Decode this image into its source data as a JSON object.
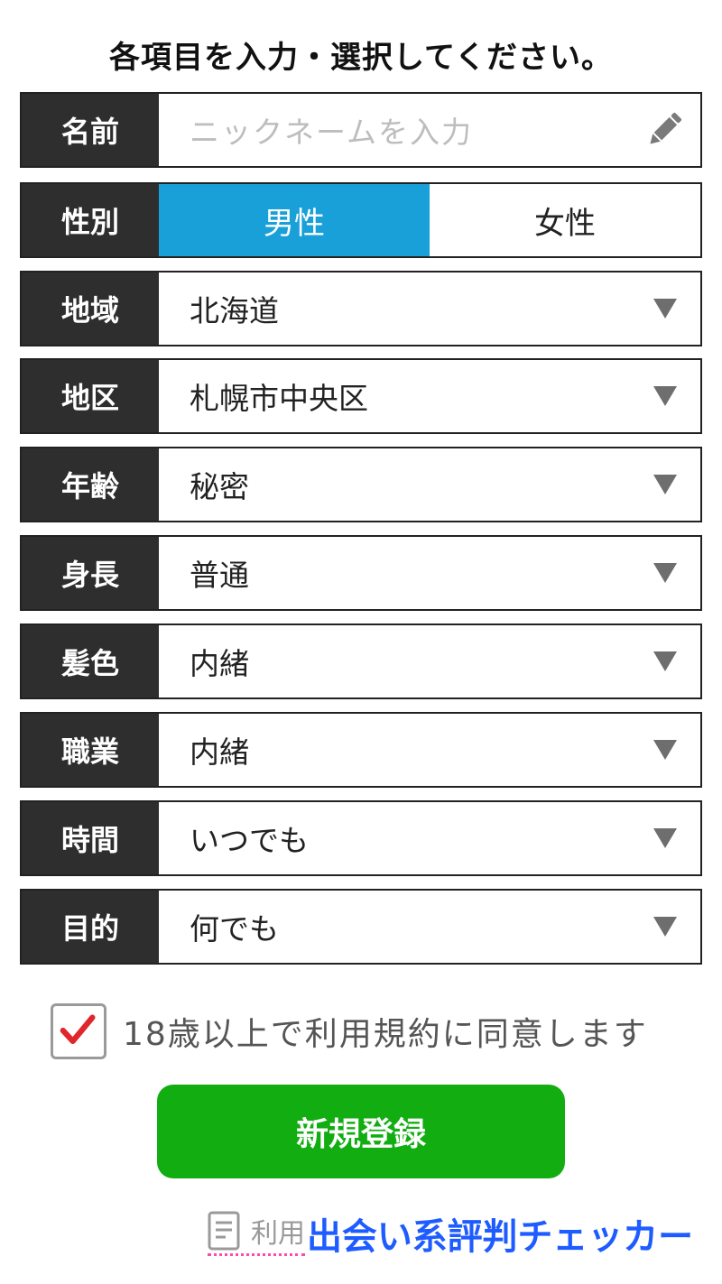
{
  "heading": "各項目を入力・選択してください。",
  "form": {
    "name": {
      "label": "名前",
      "placeholder": "ニックネームを入力"
    },
    "gender": {
      "label": "性別",
      "options": [
        "男性",
        "女性"
      ],
      "selected": "男性"
    },
    "region": {
      "label": "地域",
      "value": "北海道"
    },
    "district": {
      "label": "地区",
      "value": "札幌市中央区"
    },
    "age": {
      "label": "年齢",
      "value": "秘密"
    },
    "height": {
      "label": "身長",
      "value": "普通"
    },
    "hair": {
      "label": "髪色",
      "value": "内緒"
    },
    "job": {
      "label": "職業",
      "value": "内緒"
    },
    "time": {
      "label": "時間",
      "value": "いつでも"
    },
    "purpose": {
      "label": "目的",
      "value": "何でも"
    }
  },
  "agree": {
    "text": "18歳以上で利用規約に同意します",
    "checked": true
  },
  "submit_label": "新規登録",
  "terms_link": "利用",
  "watermark": "出会い系評判チェッカー",
  "colors": {
    "label_bg": "#2e2e2e",
    "gender_active": "#1aa0d8",
    "submit_bg": "#11ad11",
    "check_mark": "#e0262c",
    "link_underline": "#ff4aa8",
    "watermark_fill": "#1e5cff"
  },
  "icons": {
    "name_field": "pencil-icon",
    "select": "caret-down-icon",
    "agree": "checkbox-checked-icon",
    "terms": "document-icon"
  }
}
